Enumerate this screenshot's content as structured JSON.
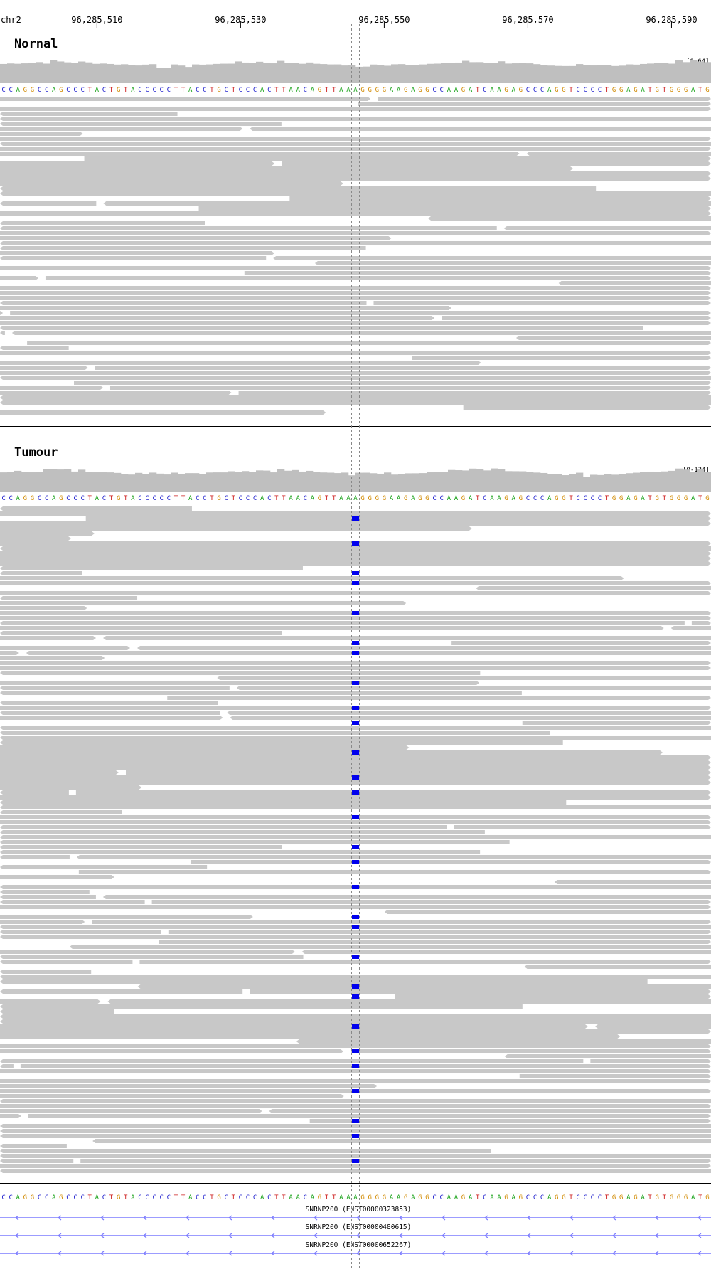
{
  "ruler": {
    "chromosome": "chr2",
    "ticks": [
      {
        "label": "96,285,510",
        "pos": 96285510
      },
      {
        "label": "96,285,530",
        "pos": 96285530
      },
      {
        "label": "96,285,550",
        "pos": 96285550
      },
      {
        "label": "96,285,570",
        "pos": 96285570
      },
      {
        "label": "96,285,590",
        "pos": 96285590
      }
    ]
  },
  "reference_sequence": "CCAGGCCAGCCCTACTGTACCCCCTTACCTGCTCCCACTTAACAGTTAAAGGGGAAGAGGCCAAGATCAAGAGCCCAGGTCCCCTGGAGATGTGGGATG",
  "tracks": [
    {
      "name": "Nornal",
      "range": "[0-64]",
      "highlighted_variants": 0
    },
    {
      "name": "Tumour",
      "range": "[0-134]",
      "highlighted_variants": 29
    }
  ],
  "genes": [
    {
      "label": "SNRNP200 (ENST00000323853)",
      "strand": "-"
    },
    {
      "label": "SNRNP200 (ENST00000480615)",
      "strand": "-"
    },
    {
      "label": "SNRNP200 (ENST00000652267)",
      "strand": "-"
    }
  ],
  "colors": {
    "A": "#1aa31a",
    "C": "#1a1acc",
    "G": "#d18a00",
    "T": "#cc1a1a",
    "read": "#c8c8c8",
    "coverage": "#bfbfbf",
    "variant": "#0000ee",
    "gene": "#7b7bff"
  }
}
